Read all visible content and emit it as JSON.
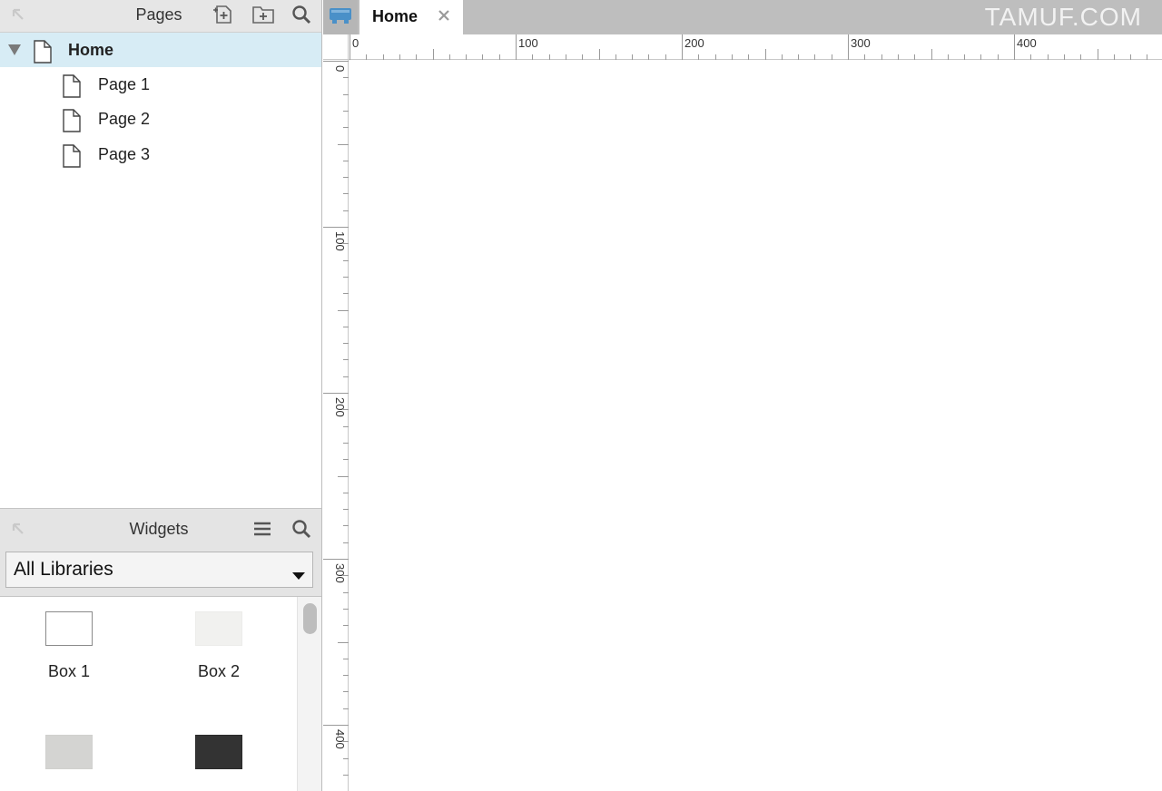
{
  "pages_panel": {
    "title": "Pages",
    "items": [
      {
        "label": "Home",
        "selected": true
      },
      {
        "label": "Page 1"
      },
      {
        "label": "Page 2"
      },
      {
        "label": "Page 3"
      }
    ]
  },
  "widgets_panel": {
    "title": "Widgets",
    "library": "All Libraries",
    "widgets": [
      {
        "label": "Box 1"
      },
      {
        "label": "Box 2"
      }
    ]
  },
  "tabs": {
    "active": {
      "label": "Home",
      "close_glyph": "×"
    }
  },
  "watermark": "TAMUF.COM",
  "rulers": {
    "horizontal_labels": [
      "0",
      "100",
      "200",
      "300",
      "400"
    ],
    "vertical_labels": [
      "0",
      "100",
      "200",
      "300",
      "400"
    ]
  },
  "colors": {
    "selection": "#d7ecf5",
    "tab_bar": "#bebebe",
    "panel_header": "#e6e6e6",
    "accent_icon": "#4a90c8"
  }
}
